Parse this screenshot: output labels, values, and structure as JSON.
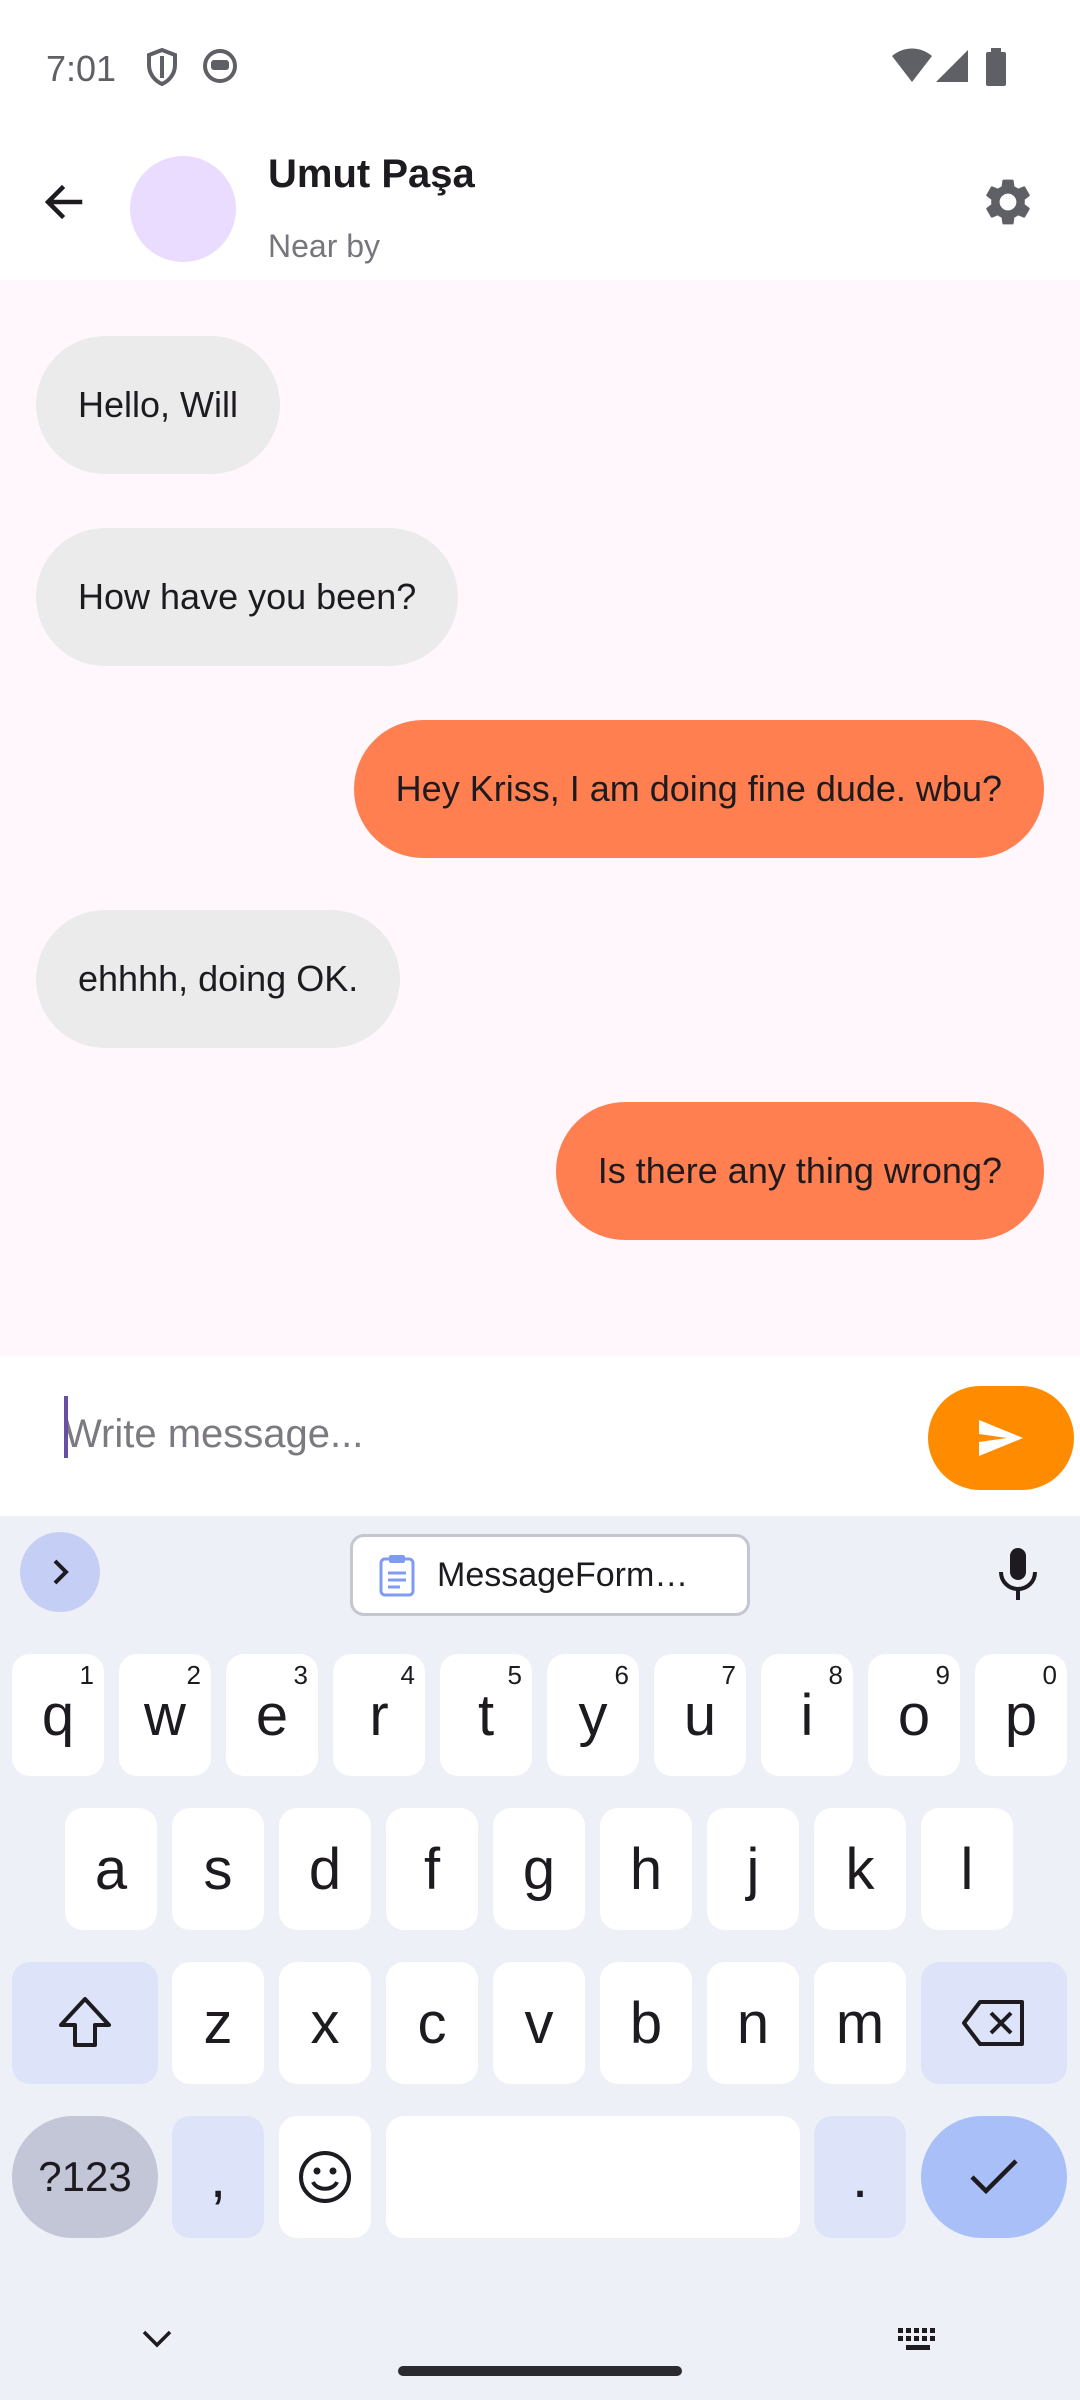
{
  "status_bar": {
    "time": "7:01"
  },
  "header": {
    "contact_name": "Umut Paşa",
    "contact_status": "Near by"
  },
  "messages": [
    {
      "text": "Hello, Will",
      "direction": "incoming"
    },
    {
      "text": "How have you been?",
      "direction": "incoming"
    },
    {
      "text": "Hey Kriss, I am doing fine dude. wbu?",
      "direction": "outgoing"
    },
    {
      "text": "ehhhh, doing OK.",
      "direction": "incoming"
    },
    {
      "text": "Is there any thing wrong?",
      "direction": "outgoing"
    }
  ],
  "composer": {
    "placeholder": "Write message..."
  },
  "keyboard": {
    "clipboard_suggestion": "MessageForm…",
    "row1": [
      {
        "key": "q",
        "hint": "1"
      },
      {
        "key": "w",
        "hint": "2"
      },
      {
        "key": "e",
        "hint": "3"
      },
      {
        "key": "r",
        "hint": "4"
      },
      {
        "key": "t",
        "hint": "5"
      },
      {
        "key": "y",
        "hint": "6"
      },
      {
        "key": "u",
        "hint": "7"
      },
      {
        "key": "i",
        "hint": "8"
      },
      {
        "key": "o",
        "hint": "9"
      },
      {
        "key": "p",
        "hint": "0"
      }
    ],
    "row2": [
      "a",
      "s",
      "d",
      "f",
      "g",
      "h",
      "j",
      "k",
      "l"
    ],
    "row3": [
      "z",
      "x",
      "c",
      "v",
      "b",
      "n",
      "m"
    ],
    "symbols_label": "?123",
    "comma_label": ",",
    "period_label": "."
  },
  "colors": {
    "incoming_bubble": "#ebebeb",
    "outgoing_bubble": "#ff7f50",
    "send_button": "#ff8c00",
    "avatar": "#eadcff",
    "chat_background": "#fff7fc"
  }
}
